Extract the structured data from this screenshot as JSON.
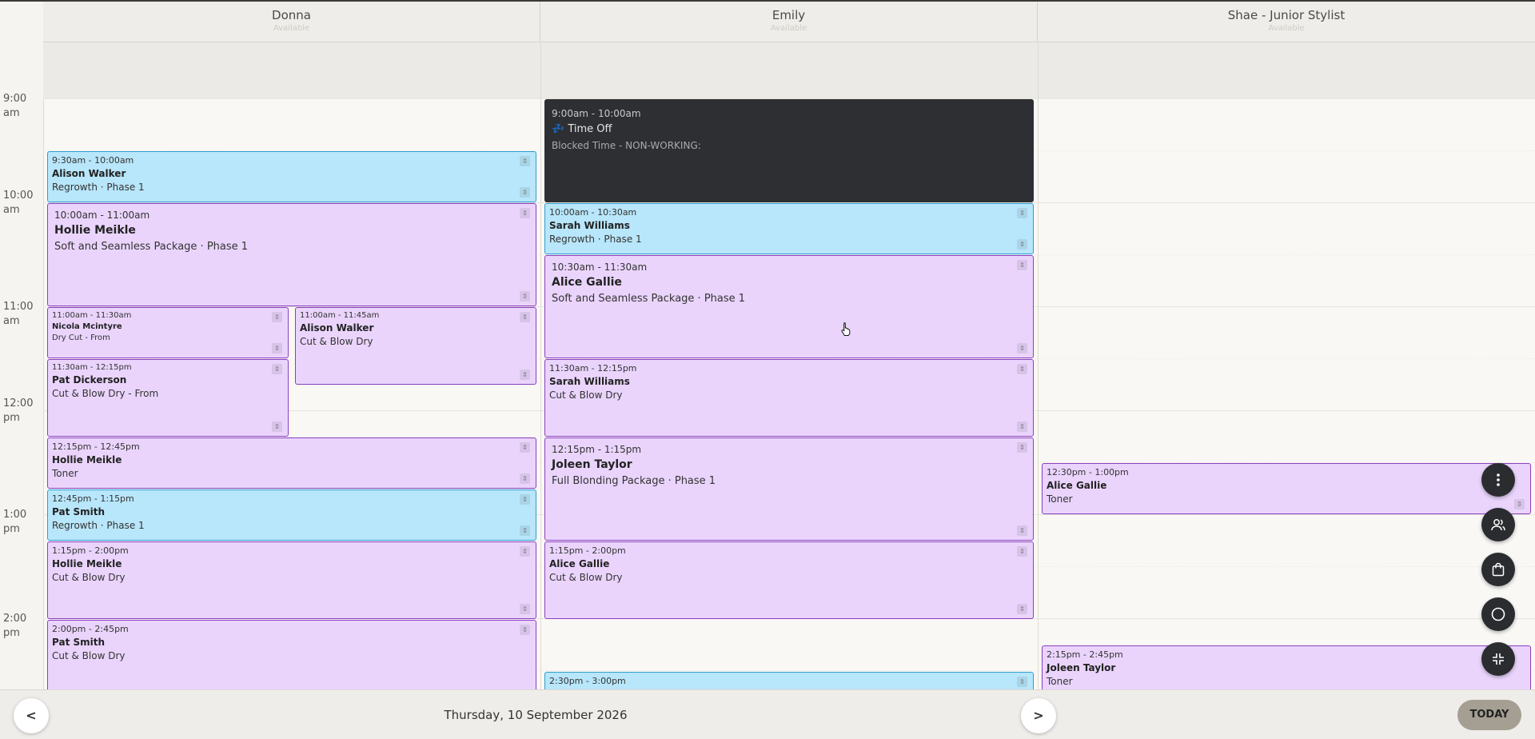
{
  "staff": [
    {
      "name": "Donna",
      "status": "Available"
    },
    {
      "name": "Emily",
      "status": "Available"
    },
    {
      "name": "Shae - Junior Stylist",
      "status": "Available"
    }
  ],
  "times": [
    "9:00 am",
    "10:00 am",
    "11:00 am",
    "12:00 pm",
    "1:00 pm",
    "2:00 pm"
  ],
  "appointments": {
    "donna": [
      {
        "time": "9:30am - 10:00am",
        "client": "Alison Walker",
        "service": "Regrowth · Phase 1"
      },
      {
        "time": "10:00am - 11:00am",
        "client": "Hollie Meikle",
        "service": "Soft and Seamless Package · Phase 1"
      },
      {
        "time": "11:00am - 11:30am",
        "client": "Nicola Mcintyre",
        "service": "Dry Cut - From"
      },
      {
        "time": "11:00am - 11:45am",
        "client": "Alison Walker",
        "service": "Cut & Blow Dry"
      },
      {
        "time": "11:30am - 12:15pm",
        "client": "Pat Dickerson",
        "service": "Cut & Blow Dry - From"
      },
      {
        "time": "12:15pm - 12:45pm",
        "client": "Hollie Meikle",
        "service": "Toner"
      },
      {
        "time": "12:45pm - 1:15pm",
        "client": "Pat Smith",
        "service": "Regrowth · Phase 1"
      },
      {
        "time": "1:15pm - 2:00pm",
        "client": "Hollie Meikle",
        "service": "Cut & Blow Dry"
      },
      {
        "time": "2:00pm - 2:45pm",
        "client": "Pat Smith",
        "service": "Cut & Blow Dry"
      }
    ],
    "emily": [
      {
        "time": "9:00am - 10:00am",
        "client": "💤 Time Off",
        "service": "Blocked Time - NON-WORKING:"
      },
      {
        "time": "10:00am - 10:30am",
        "client": "Sarah Williams",
        "service": "Regrowth · Phase 1"
      },
      {
        "time": "10:30am - 11:30am",
        "client": "Alice Gallie",
        "service": "Soft and Seamless Package · Phase 1"
      },
      {
        "time": "11:30am - 12:15pm",
        "client": "Sarah Williams",
        "service": "Cut & Blow Dry"
      },
      {
        "time": "12:15pm - 1:15pm",
        "client": "Joleen Taylor",
        "service": "Full Blonding Package · Phase 1"
      },
      {
        "time": "1:15pm - 2:00pm",
        "client": "Alice Gallie",
        "service": "Cut & Blow Dry"
      },
      {
        "time": "2:30pm - 3:00pm",
        "client": "",
        "service": ""
      }
    ],
    "shae": [
      {
        "time": "12:30pm - 1:00pm",
        "client": "Alice Gallie",
        "service": "Toner"
      },
      {
        "time": "2:15pm - 2:45pm",
        "client": "Joleen Taylor",
        "service": "Toner"
      }
    ]
  },
  "footer": {
    "prev_label": "<",
    "next_label": ">",
    "date": "Thursday, 10 September 2026",
    "today_label": "TODAY"
  },
  "fab_icons": [
    "more-vertical-icon",
    "users-icon",
    "shopping-bag-icon",
    "circle-icon",
    "collapse-icon"
  ]
}
